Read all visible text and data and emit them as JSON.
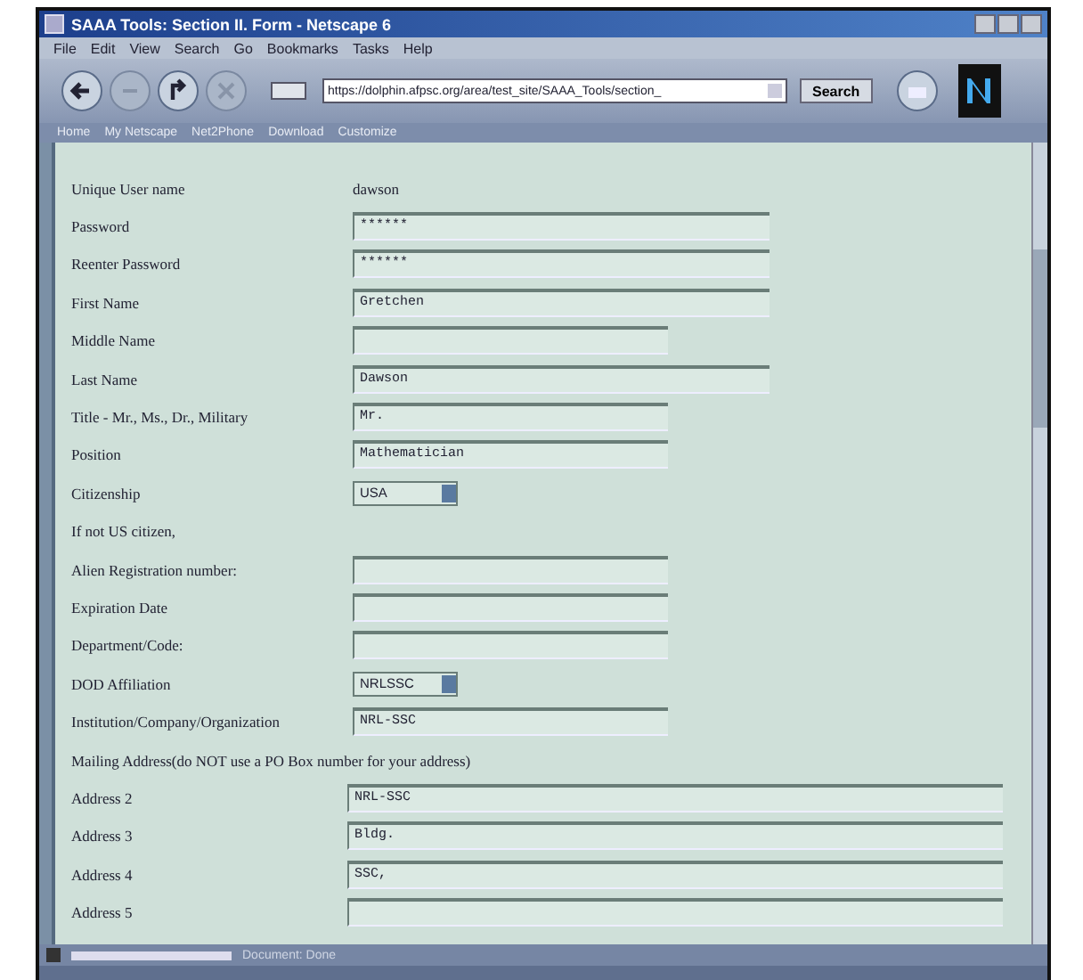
{
  "window": {
    "title": "SAAA Tools: Section II. Form - Netscape 6"
  },
  "menu": [
    "File",
    "Edit",
    "View",
    "Search",
    "Go",
    "Bookmarks",
    "Tasks",
    "Help"
  ],
  "address_bar": {
    "value": "https://dolphin.afpsc.org/area/test_site/SAAA_Tools/section_"
  },
  "search_button": "Search",
  "personal_toolbar": [
    "Home",
    "My Netscape",
    "Net2Phone",
    "Download",
    "Customize"
  ],
  "form": [
    {
      "kind": "text",
      "label": "Unique User name",
      "value": "dawson"
    },
    {
      "kind": "long_field",
      "label": "Password",
      "value": "******"
    },
    {
      "kind": "long_field",
      "label": "Reenter Password",
      "value": "******"
    },
    {
      "kind": "long_field",
      "label": "First Name",
      "value": "Gretchen"
    },
    {
      "kind": "short_field",
      "label": "Middle Name"
    },
    {
      "kind": "long_field",
      "label": "Last Name",
      "value": "Dawson"
    },
    {
      "kind": "short_field",
      "label": "Title - Mr., Ms., Dr., Military",
      "value": "Mr."
    },
    {
      "kind": "short_field",
      "label": "Position",
      "value": "Mathematician"
    },
    {
      "kind": "select",
      "label": "Citizenship",
      "value": "USA"
    },
    {
      "kind": "note",
      "label": "If not US citizen,"
    },
    {
      "kind": "short_field",
      "label": "Alien Registration number:"
    },
    {
      "kind": "short_field",
      "label": "Expiration Date"
    },
    {
      "kind": "short_field",
      "label": "Department/Code:"
    },
    {
      "kind": "select",
      "label": "DOD Affiliation",
      "value": "NRLSSC"
    },
    {
      "kind": "short_field",
      "label": "Institution/Company/Organization",
      "value": "NRL-SSC"
    },
    {
      "kind": "note",
      "label": "Mailing Address(do NOT use a PO Box number for your address)"
    },
    {
      "kind": "address_field",
      "label": "Address 2",
      "value": "NRL-SSC"
    },
    {
      "kind": "address_field",
      "label": "Address 3",
      "value": "Bldg."
    },
    {
      "kind": "address_field",
      "label": "Address 4",
      "value": "SSC,"
    },
    {
      "kind": "address_field",
      "label": "Address 5"
    }
  ],
  "status_bar": {
    "text": "Document: Done"
  }
}
